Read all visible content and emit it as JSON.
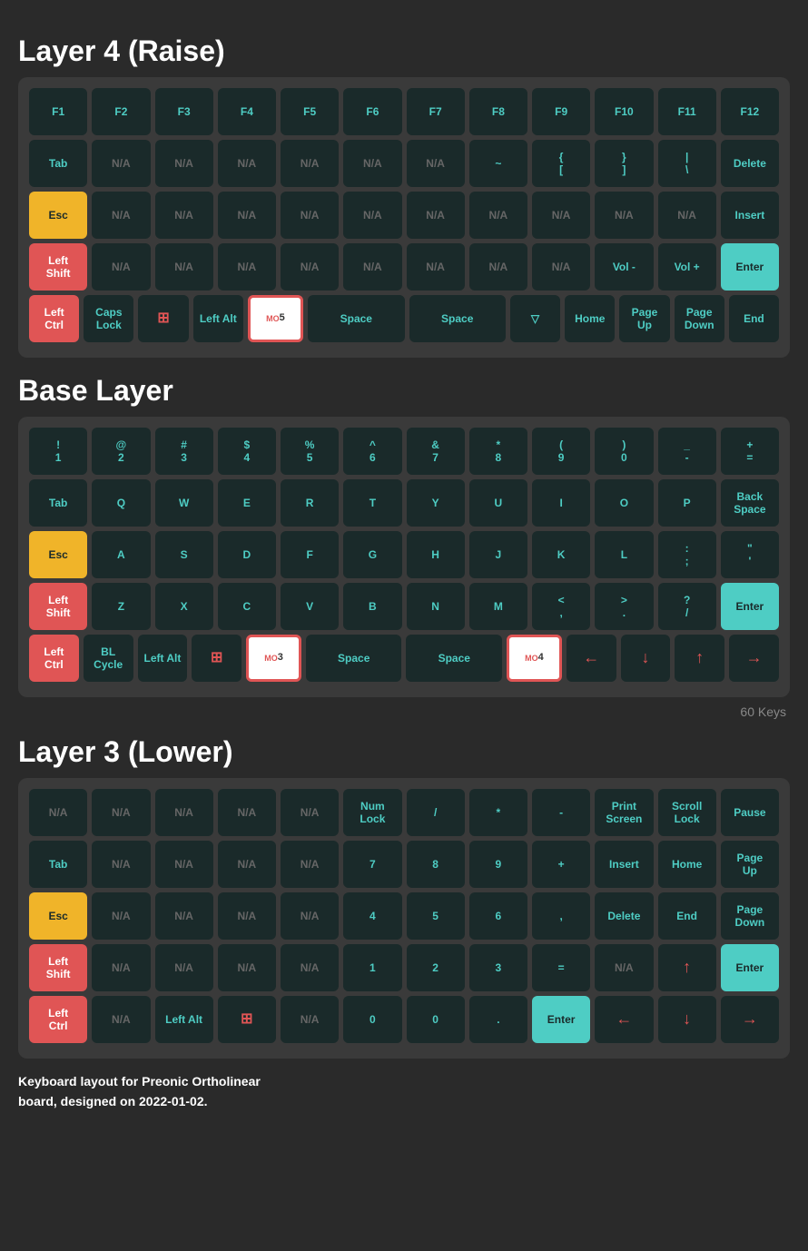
{
  "layers": [
    {
      "title": "Layer 4 (Raise)",
      "rows": [
        [
          "F1",
          "F2",
          "F3",
          "F4",
          "F5",
          "F6",
          "F7",
          "F8",
          "F9",
          "F10",
          "F11",
          "F12"
        ],
        [
          "Tab",
          "N/A",
          "N/A",
          "N/A",
          "N/A",
          "N/A",
          "N/A",
          "~",
          "{\n[",
          "}\n]",
          "|\\",
          "Delete"
        ],
        [
          "Esc",
          "N/A",
          "N/A",
          "N/A",
          "N/A",
          "N/A",
          "N/A",
          "N/A",
          "N/A",
          "N/A",
          "N/A",
          "Insert"
        ],
        [
          "Left\nShift",
          "N/A",
          "N/A",
          "N/A",
          "N/A",
          "N/A",
          "N/A",
          "N/A",
          "N/A",
          "Vol -",
          "Vol +",
          "Enter"
        ],
        [
          "Left\nCtrl",
          "Caps\nLock",
          "WIN",
          "Left Alt",
          "MO\n5",
          "Space",
          "Space",
          "▽",
          "Home",
          "Page\nUp",
          "Page\nDown",
          "End"
        ]
      ]
    },
    {
      "title": "Base Layer",
      "rows": [
        [
          "!\n1",
          "@\n2",
          "#\n3",
          "$\n4",
          "%\n5",
          "^\n6",
          "&\n7",
          "*\n8",
          "(\n9",
          ")\n0",
          "_\n-",
          "+\n="
        ],
        [
          "Tab",
          "Q",
          "W",
          "E",
          "R",
          "T",
          "Y",
          "U",
          "I",
          "O",
          "P",
          "Back\nSpace"
        ],
        [
          "Esc",
          "A",
          "S",
          "D",
          "F",
          "G",
          "H",
          "J",
          "K",
          "L",
          ":\n;",
          "\"\n'"
        ],
        [
          "Left\nShift",
          "Z",
          "X",
          "C",
          "V",
          "B",
          "N",
          "M",
          "<\n,",
          ">\n.",
          "?\n/",
          "Enter"
        ],
        [
          "Left\nCtrl",
          "BL\nCycle",
          "Left Alt",
          "WIN",
          "MO\n3",
          "Space",
          "Space",
          "MO\n4",
          "←",
          "↓",
          "↑",
          "→"
        ]
      ]
    },
    {
      "title": "Layer 3 (Lower)",
      "rows": [
        [
          "N/A",
          "N/A",
          "N/A",
          "N/A",
          "N/A",
          "Num\nLock",
          "/",
          "*",
          "-",
          "Print\nScreen",
          "Scroll\nLock",
          "Pause"
        ],
        [
          "Tab",
          "N/A",
          "N/A",
          "N/A",
          "N/A",
          "7",
          "8",
          "9",
          "+",
          "Insert",
          "Home",
          "Page\nUp"
        ],
        [
          "Esc",
          "N/A",
          "N/A",
          "N/A",
          "N/A",
          "4",
          "5",
          "6",
          ",",
          "Delete",
          "End",
          "Page\nDown"
        ],
        [
          "Left\nShift",
          "N/A",
          "N/A",
          "N/A",
          "N/A",
          "1",
          "2",
          "3",
          "=",
          "N/A",
          "↑",
          "Enter"
        ],
        [
          "Left\nCtrl",
          "N/A",
          "Left Alt",
          "WIN",
          "N/A",
          "0",
          "0",
          ".",
          "Enter",
          "←",
          "↓",
          "→"
        ]
      ]
    }
  ],
  "footer": "Keyboard layout for Preonic Ortholinear\nboard, designed on 2022-01-02."
}
